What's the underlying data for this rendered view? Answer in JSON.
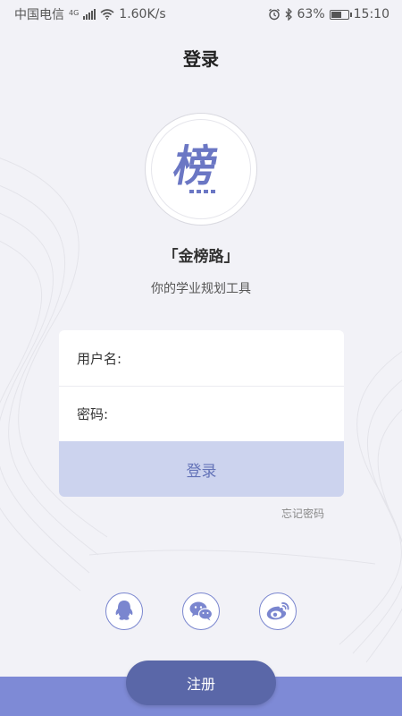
{
  "status_bar": {
    "carrier": "中国电信",
    "network_type": "4G",
    "speed": "1.60K/s",
    "battery": "63%",
    "battery_level": 0.63,
    "time": "15:10"
  },
  "header": {
    "title": "登录"
  },
  "logo": {
    "glyph": "榜"
  },
  "app": {
    "name": "「金榜路」",
    "tagline": "你的学业规划工具"
  },
  "form": {
    "username_label": "用户名:",
    "username_value": "",
    "password_label": "密码:",
    "password_value": "",
    "login_label": "登录"
  },
  "forgot_password": "忘记密码",
  "social": [
    "qq-icon",
    "wechat-icon",
    "weibo-icon"
  ],
  "register_label": "注册",
  "colors": {
    "accent": "#7e8ad6",
    "register": "#5a67a8",
    "login_button": "#ccd3ee"
  }
}
